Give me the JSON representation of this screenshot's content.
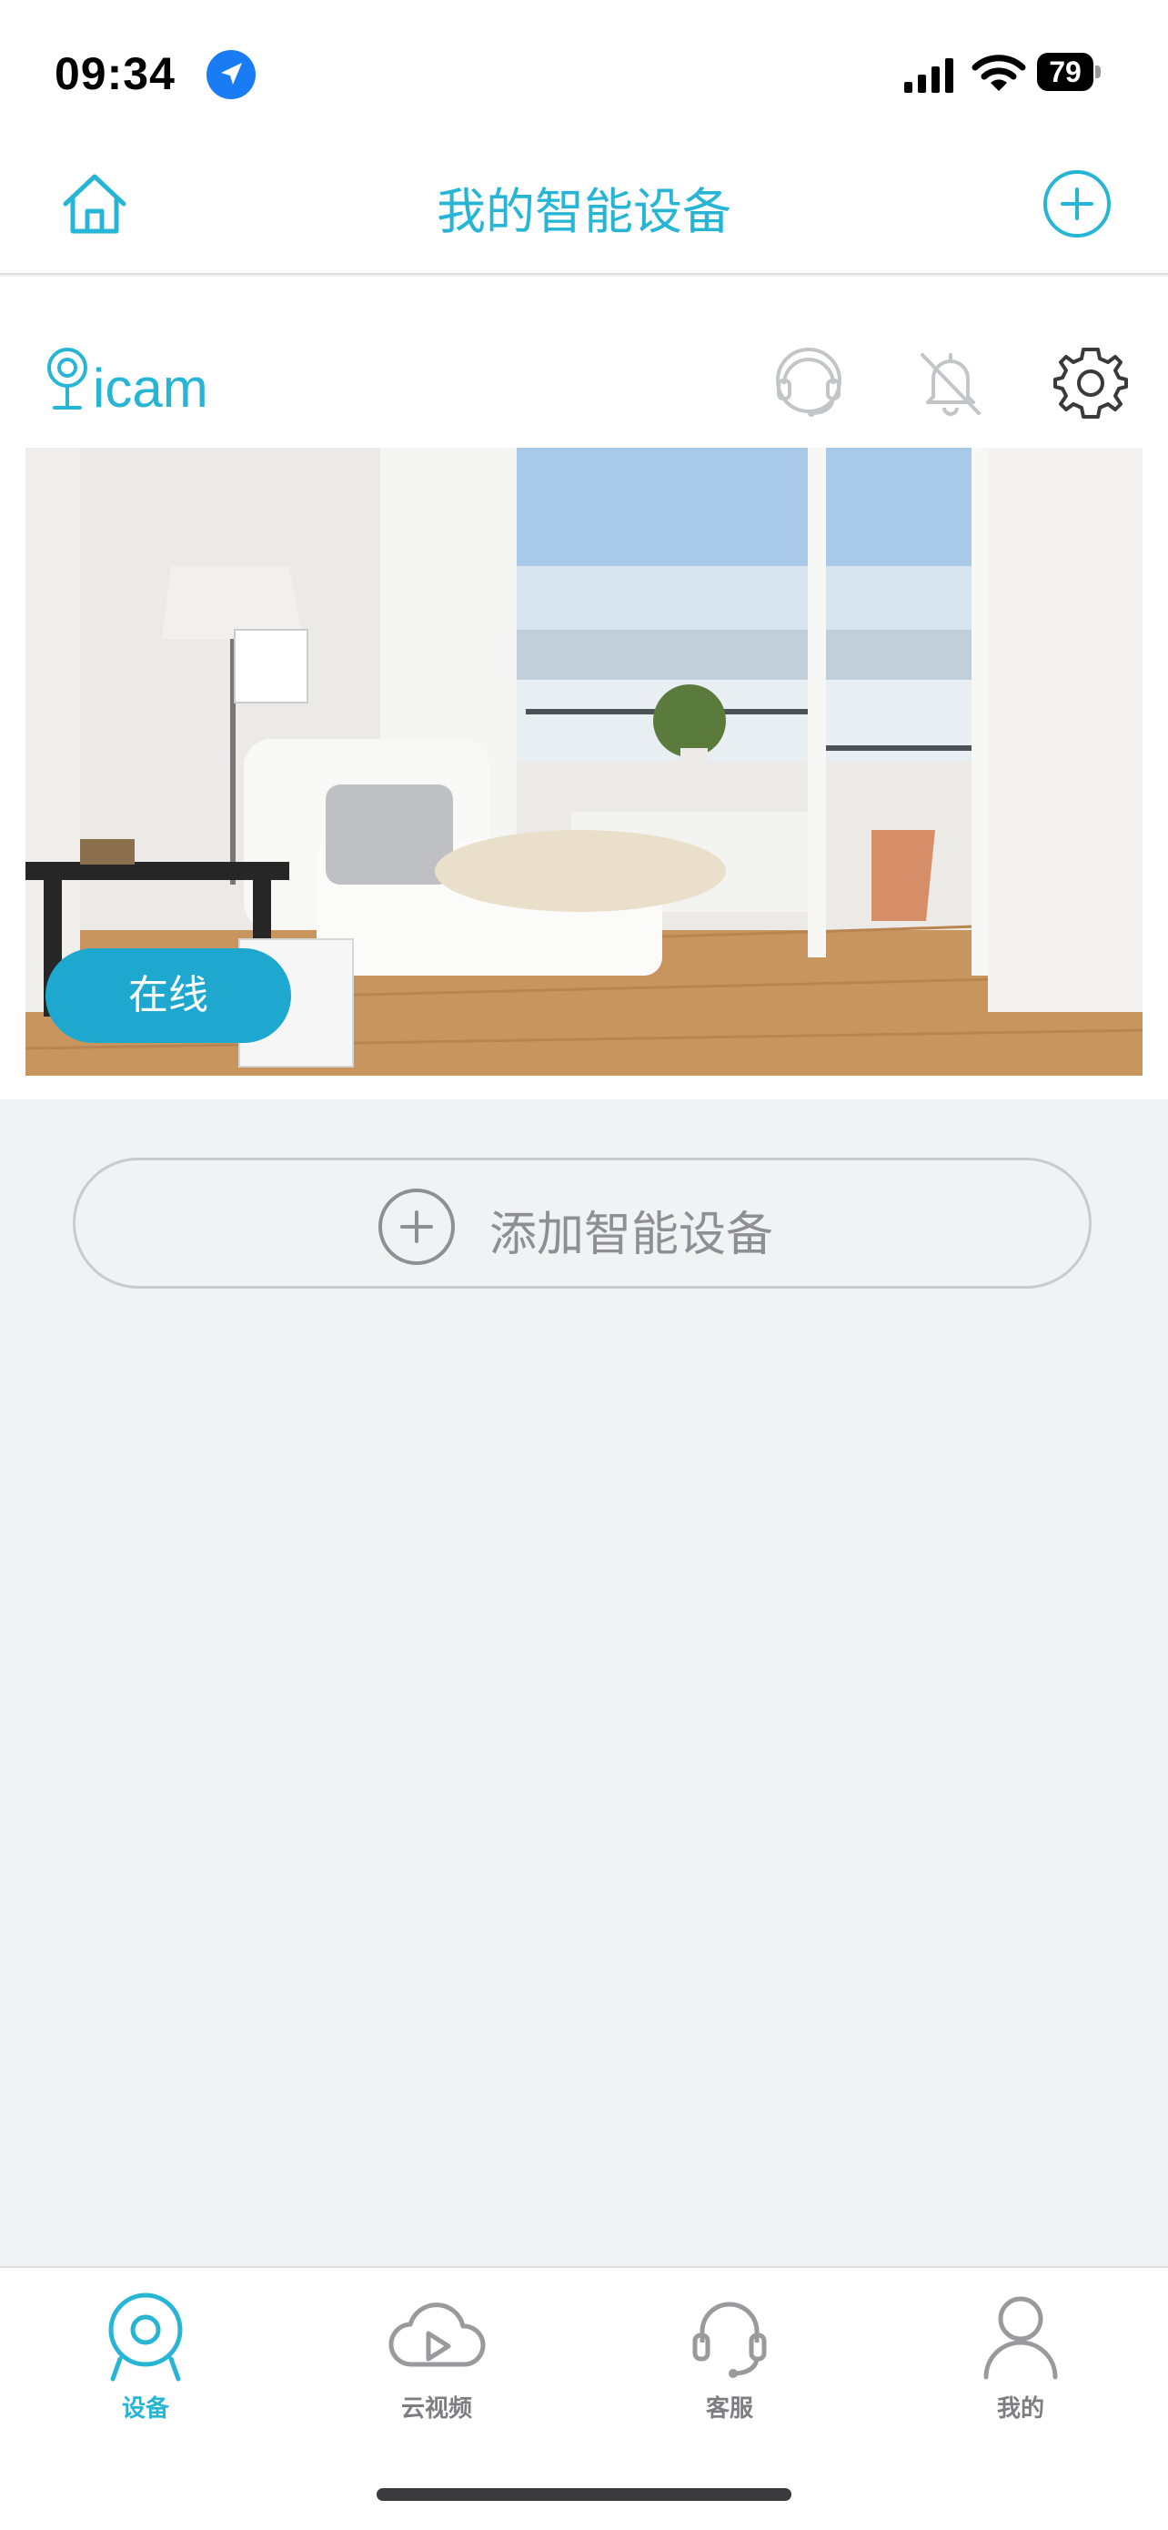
{
  "status_bar": {
    "time": "09:34",
    "battery": "79"
  },
  "header": {
    "title": "我的智能设备",
    "icons": [
      "home-icon",
      "add-circle-icon"
    ]
  },
  "device_card": {
    "brand": "icam",
    "icons": [
      "customer-service-icon",
      "bell-off-icon",
      "gear-icon"
    ],
    "status": "在线"
  },
  "add_device": {
    "label": "添加智能设备",
    "icon": "add-circle-icon"
  },
  "tabs": [
    {
      "label": "设备",
      "icon": "camera-icon",
      "active": true
    },
    {
      "label": "云视频",
      "icon": "cloud-play-icon",
      "active": false
    },
    {
      "label": "客服",
      "icon": "headset-icon",
      "active": false
    },
    {
      "label": "我的",
      "icon": "user-icon",
      "active": false
    }
  ],
  "colors": {
    "accent": "#27b5d6",
    "badge": "#1fa8cf",
    "background": "#f1f2f4",
    "inactive": "#7d7d82"
  }
}
